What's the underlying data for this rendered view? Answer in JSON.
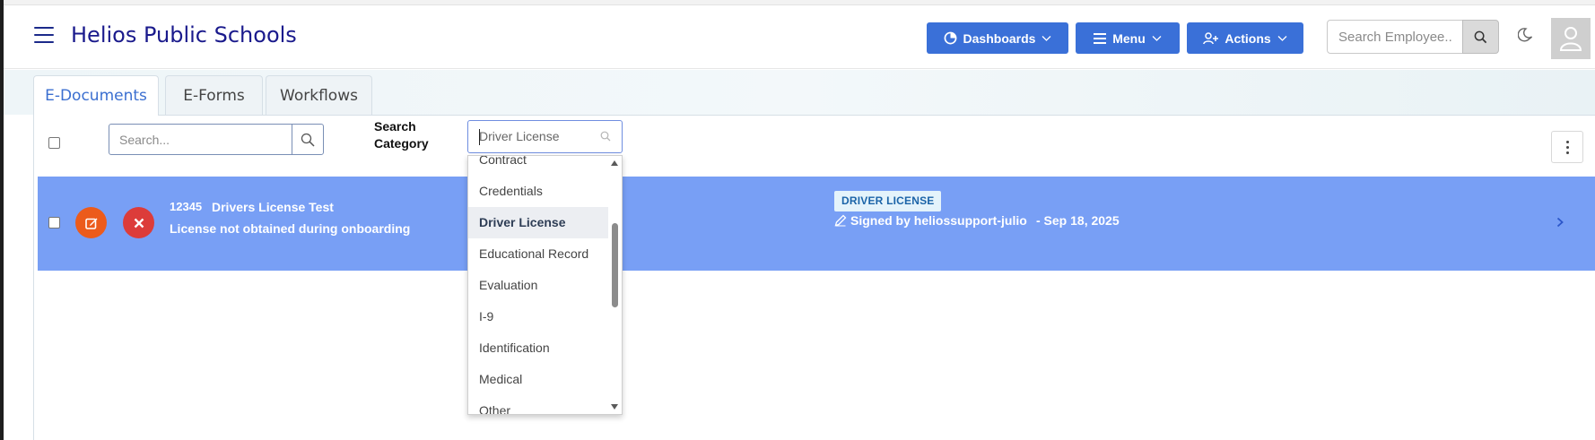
{
  "header": {
    "brand": "Helios Public Schools",
    "dashboards_label": "Dashboards",
    "menu_label": "Menu",
    "actions_label": "Actions",
    "search_placeholder": "Search Employee..",
    "icons": [
      "hamburger-icon",
      "pie-chart-icon",
      "list-icon",
      "user-plus-icon",
      "chevron-down-icon",
      "search-icon",
      "moon-icon",
      "user-icon"
    ]
  },
  "tabs": [
    {
      "label": "E-Documents",
      "active": true
    },
    {
      "label": "E-Forms",
      "active": false
    },
    {
      "label": "Workflows",
      "active": false
    }
  ],
  "toolbar": {
    "search_placeholder": "Search...",
    "search_category_label": "Search Category",
    "category_value": "Driver License"
  },
  "dropdown": {
    "options": [
      "Contract",
      "Credentials",
      "Driver License",
      "Educational Record",
      "Evaluation",
      "I-9",
      "Identification",
      "Medical",
      "Other"
    ],
    "selected": "Driver License"
  },
  "document": {
    "id": "12345",
    "title": "Drivers License Test",
    "note": "License not obtained during onboarding",
    "category_badge": "DRIVER LICENSE",
    "signed_text": "Signed by heliossupport-julio",
    "date_text": "- Sep 18, 2025"
  },
  "colors": {
    "brand": "#1a1a8c",
    "button": "#3a70d8",
    "row": "#789ff5",
    "edit": "#ec5b1b",
    "delete": "#dc3c3a"
  }
}
